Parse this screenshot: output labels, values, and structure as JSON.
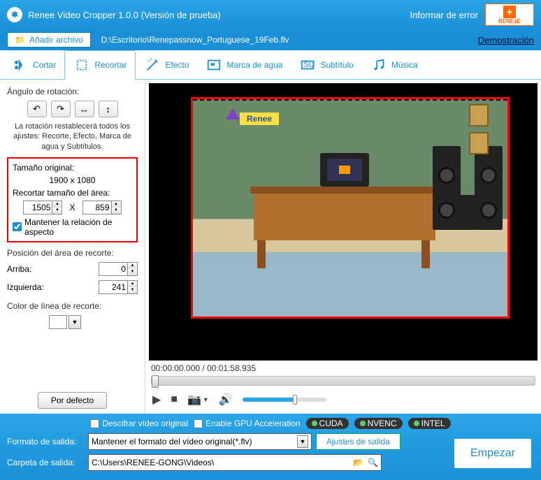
{
  "titlebar": {
    "app_icon": "✱",
    "title": "Renee Video Cropper 1.0.0 (Versión de prueba)",
    "report": "Informar de error",
    "logo_text": "RENEE Laboratory"
  },
  "filebar": {
    "add_label": "Añadir archivo",
    "path": "D:\\Escritorio\\Renepassnow_Portuguese_19Feb.flv",
    "demo": "Demostración"
  },
  "tabs": {
    "cut": "Cortar",
    "crop": "Recortar",
    "effect": "Efecto",
    "watermark": "Marca de agua",
    "subtitle": "Subtítulo",
    "music": "Música"
  },
  "sidebar": {
    "rotation_label": "Ángulo de rotación:",
    "rotation_note": "La rotación restablecerá todos los ajustes: Recorte, Efecto, Marca de agua y Subtítulos.",
    "orig_size_label": "Tamaño original:",
    "orig_size_value": "1900 x 1080",
    "crop_size_label": "Recortar tamaño del área:",
    "width": "1505",
    "x": "X",
    "height": "859",
    "keep_aspect": "Mantener la relación de aspecto",
    "pos_label": "Posición del área de recorte:",
    "top_label": "Arriba:",
    "top_value": "0",
    "left_label": "Izquierda:",
    "left_value": "241",
    "line_color_label": "Color de línea de recorte:",
    "default_btn": "Por defecto"
  },
  "preview": {
    "time": "00:00:00.000 / 00:01:58.935",
    "renee_tag": "Renee"
  },
  "footer": {
    "decode_label": "Descifrar vídeo original",
    "gpu_label": "Enable GPU Acceleration",
    "badges": [
      "CUDA",
      "NVENC",
      "INTEL"
    ],
    "format_label": "Formato de salida:",
    "format_value": "Mantener el formato del vídeo original(*.flv)",
    "settings_btn": "Ajustes de salida",
    "folder_label": "Carpeta de salida:",
    "folder_value": "C:\\Users\\RENEE-GONG\\Videos\\",
    "start_btn": "Empezar"
  }
}
